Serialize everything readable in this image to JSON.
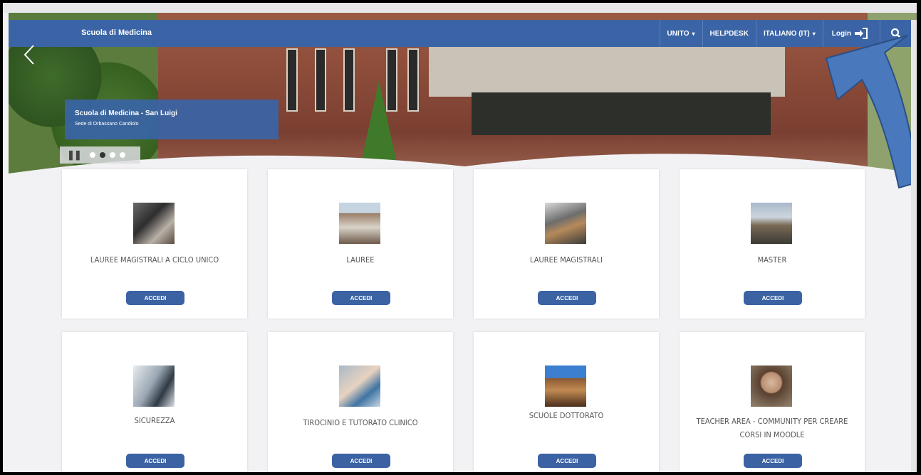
{
  "navbar": {
    "brand": "Scuola di Medicina",
    "items": [
      {
        "label": "UNITO",
        "caret": "▾"
      },
      {
        "label": "HELPDESK"
      },
      {
        "label": "ITALIANO (IT)",
        "caret": "▾"
      }
    ],
    "login_label": "Login"
  },
  "hero": {
    "caption_title": "Scuola di Medicina - San Luigi",
    "caption_subtitle": "Sede di Orbassano Candiolo",
    "slides": 4,
    "active_slide": 2
  },
  "cards": [
    {
      "label": "LAUREE MAGISTRALI A CICLO UNICO",
      "button": "ACCEDI",
      "icon": "doctor-desk-photo"
    },
    {
      "label": "LAUREE",
      "button": "ACCEDI",
      "icon": "building-entrance-photo"
    },
    {
      "label": "LAUREE MAGISTRALI",
      "button": "ACCEDI",
      "icon": "lecture-hall-photo"
    },
    {
      "label": "MASTER",
      "button": "ACCEDI",
      "icon": "conference-photo"
    },
    {
      "label": "SICUREZZA",
      "button": "ACCEDI",
      "icon": "laboratory-photo"
    },
    {
      "label": "TIROCINIO E TUTORATO CLINICO",
      "button": "ACCEDI",
      "icon": "clinical-photo"
    },
    {
      "label": "SCUOLE DOTTORATO",
      "button": "ACCEDI",
      "icon": "theatre-photo"
    },
    {
      "label": "TEACHER AREA - COMMUNITY PER CREARE CORSI IN MOODLE",
      "button": "ACCEDI",
      "icon": "teacher-photo"
    }
  ],
  "colors": {
    "primary": "#3a64a6",
    "button": "#3b62a3",
    "annotation": "#4a78bd"
  }
}
